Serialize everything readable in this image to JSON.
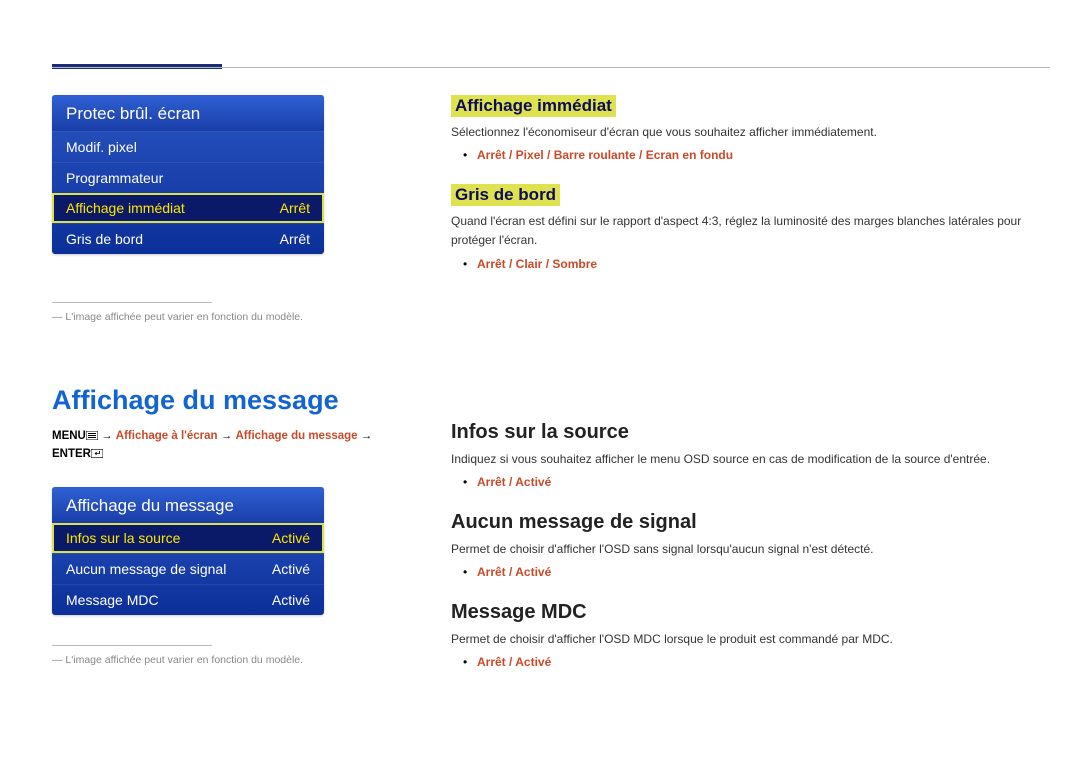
{
  "menu1": {
    "title": "Protec brûl. écran",
    "items": [
      {
        "label": "Modif. pixel",
        "value": ""
      },
      {
        "label": "Programmateur",
        "value": ""
      },
      {
        "label": "Affichage immédiat",
        "value": "Arrêt",
        "selected": true
      },
      {
        "label": "Gris de bord",
        "value": "Arrêt"
      }
    ]
  },
  "footnote1": "― L'image affichée peut varier en fonction du modèle.",
  "doc_heading": "Affichage du message",
  "breadcrumb": {
    "menu": "MENU",
    "path1": "Affichage à l'écran",
    "path2": "Affichage du message",
    "enter": "ENTER"
  },
  "menu2": {
    "title": "Affichage du message",
    "items": [
      {
        "label": "Infos sur la source",
        "value": "Activé",
        "selected": true
      },
      {
        "label": "Aucun message de signal",
        "value": "Activé"
      },
      {
        "label": "Message MDC",
        "value": "Activé"
      }
    ]
  },
  "footnote2": "― L'image affichée peut varier en fonction du modèle.",
  "right": {
    "s1": {
      "heading": "Affichage immédiat",
      "desc": "Sélectionnez l'économiseur d'écran que vous souhaitez afficher immédiatement.",
      "opts": "Arrêt / Pixel / Barre roulante / Ecran en fondu"
    },
    "s2": {
      "heading": "Gris de bord",
      "desc": "Quand l'écran est défini sur le rapport d'aspect 4:3, réglez la luminosité des marges blanches latérales pour protéger l'écran.",
      "opts": "Arrêt / Clair / Sombre"
    },
    "s3": {
      "heading": "Infos sur la source",
      "desc": "Indiquez si vous souhaitez afficher le menu OSD source en cas de modification de la source d'entrée.",
      "opts": "Arrêt / Activé"
    },
    "s4": {
      "heading": "Aucun message de signal",
      "desc": "Permet de choisir d'afficher l'OSD sans signal lorsqu'aucun signal n'est détecté.",
      "opts": "Arrêt / Activé"
    },
    "s5": {
      "heading": "Message MDC",
      "desc": "Permet de choisir d'afficher l'OSD MDC lorsque le produit est commandé par MDC.",
      "opts": "Arrêt / Activé"
    }
  }
}
